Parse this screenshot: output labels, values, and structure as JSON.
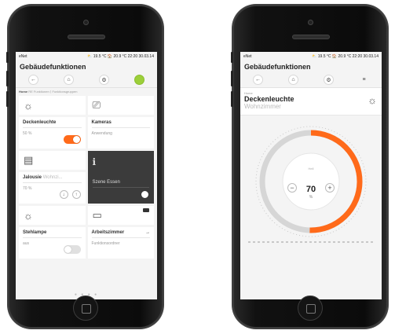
{
  "colors": {
    "accent": "#ff6a1a",
    "green": "#9ccf3a",
    "scene_bg": "#3b3b3b"
  },
  "phone1": {
    "status": {
      "carrier": "eNet",
      "weather": "⛅ 19.5 °C  🏠 20.9 °C  22:20  30.03.14"
    },
    "title": "Gebäudefunktionen",
    "nav_icons": [
      "back-arrow-icon",
      "home-icon",
      "settings-icon",
      "green-status-icon"
    ],
    "breadcrumb": {
      "home": "Home",
      "rest": "  RE Funktionen  ⟩  Funktionsgruppen"
    },
    "tiles": [
      {
        "name": "Deckenleuchte",
        "value": "50 %",
        "icon": "lightbulb-icon",
        "state": "on"
      },
      {
        "name": "Kameras",
        "value": "Anwendung",
        "icon": "camera-icon"
      },
      {
        "name": "Jalousie",
        "value_suffix": "Wohnzi...",
        "value": "70 %",
        "icon": "blind-icon"
      },
      {
        "name": "Szene Essen",
        "icon": "cutlery-icon",
        "state": "on"
      },
      {
        "name": "Stehlampe",
        "value": "aus",
        "icon": "lightbulb-icon",
        "state": "off"
      },
      {
        "name": "Arbeitszimmer",
        "value": "Funktionsordner",
        "icon": "monitor-icon",
        "arrow": "→"
      }
    ],
    "page_dots": "● ● ● ●"
  },
  "phone2": {
    "status": {
      "carrier": "eNet",
      "weather": "⛅ 19.5 °C  🏠 20.9 °C  22:20  30.03.14"
    },
    "title": "Gebäudefunktionen",
    "nav_icons": [
      "back-arrow-icon",
      "home-icon",
      "settings-icon",
      "menu-icon"
    ],
    "detail": {
      "home": "Home",
      "name": "Deckenleuchte",
      "room": "Wohnzimmer"
    },
    "dial": {
      "label": "Hell",
      "value": "70",
      "unit": "%",
      "minus": "−",
      "plus": "+",
      "level_percent": 70
    }
  }
}
